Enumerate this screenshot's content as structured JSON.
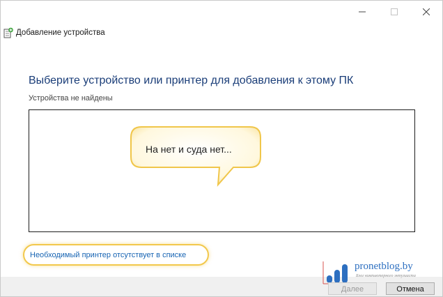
{
  "window": {
    "minimize_icon": "minimize-icon",
    "maximize_icon": "maximize-icon",
    "close_icon": "close-icon"
  },
  "header": {
    "title": "Добавление устройства",
    "icon": "printer-add-icon"
  },
  "main": {
    "heading": "Выберите устройство или принтер для добавления к этому ПК",
    "status": "Устройства не найдены",
    "callout_text": "На нет и суда нет...",
    "missing_printer_link": "Необходимый принтер отсутствует в списке"
  },
  "footer": {
    "next_label": "Далее",
    "cancel_label": "Отмена"
  },
  "watermark": {
    "name": "pronetblog.by",
    "tagline": "Блог компьютерного энтузиаста"
  },
  "colors": {
    "heading": "#1a3d78",
    "link": "#1764b3",
    "highlight": "#f2c84b",
    "watermark": "#2d6fc0"
  }
}
